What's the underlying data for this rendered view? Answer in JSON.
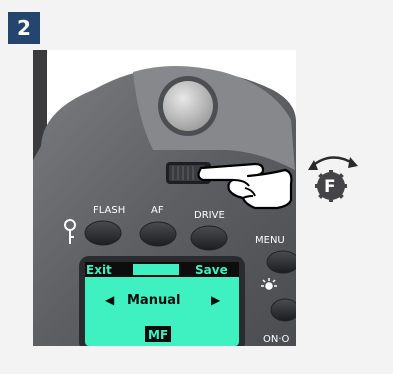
{
  "step": {
    "number": "2"
  },
  "camera": {
    "buttons": {
      "flash": "FLASH",
      "af": "AF",
      "drive": "DRIVE",
      "menu": "MENU",
      "power": "ON·O"
    },
    "lcd": {
      "left_softkey": "Exit",
      "right_softkey": "Save",
      "mode_value": "Manual",
      "focus_badge": "MF",
      "screen_color": "#3ff0c0"
    }
  },
  "function_dial_icon": {
    "letter": "F",
    "icon": "rotate-dial-icon"
  }
}
